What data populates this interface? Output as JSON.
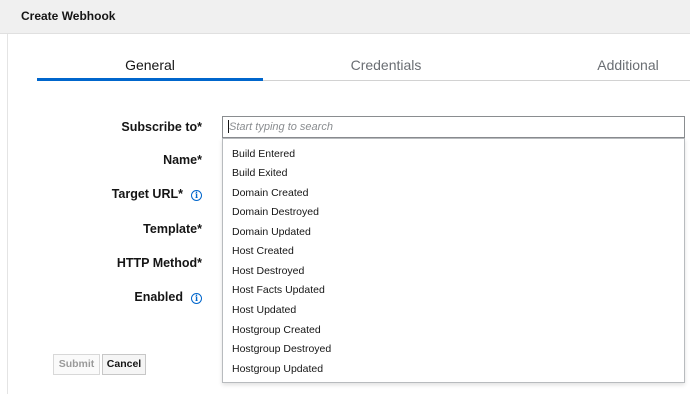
{
  "modal": {
    "title": "Create Webhook"
  },
  "tabs": [
    {
      "label": "General",
      "active": true
    },
    {
      "label": "Credentials",
      "active": false
    },
    {
      "label": "Additional",
      "active": false
    }
  ],
  "form": {
    "subscribe_to": {
      "label": "Subscribe to*",
      "placeholder": "Start typing to search"
    },
    "name": {
      "label": "Name*"
    },
    "target_url": {
      "label": "Target URL*"
    },
    "template": {
      "label": "Template*"
    },
    "http_method": {
      "label": "HTTP Method*"
    },
    "enabled": {
      "label": "Enabled"
    }
  },
  "dropdown": {
    "options": [
      "Build Entered",
      "Build Exited",
      "Domain Created",
      "Domain Destroyed",
      "Domain Updated",
      "Host Created",
      "Host Destroyed",
      "Host Facts Updated",
      "Host Updated",
      "Hostgroup Created",
      "Hostgroup Destroyed",
      "Hostgroup Updated"
    ]
  },
  "buttons": {
    "submit": "Submit",
    "cancel": "Cancel"
  },
  "icons": {
    "info": "info-circle-icon"
  },
  "colors": {
    "accent": "#0066cc"
  }
}
